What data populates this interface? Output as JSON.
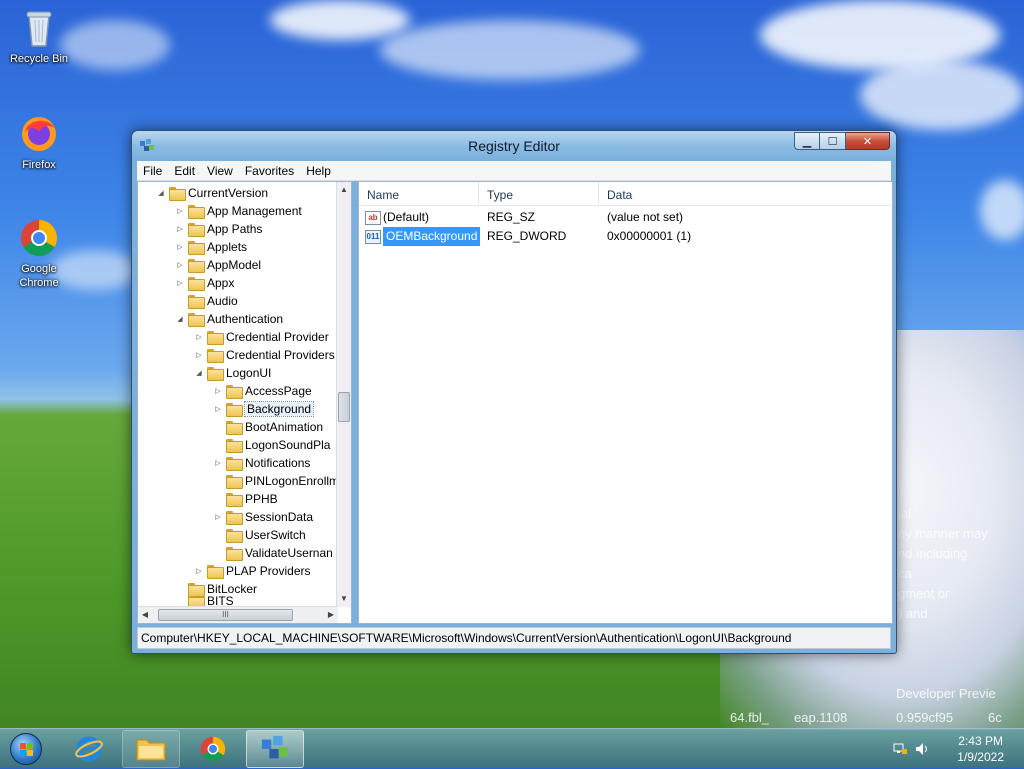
{
  "desktop": {
    "icons": [
      {
        "label": "Recycle Bin"
      },
      {
        "label": "Firefox"
      },
      {
        "label": "Google Chrome"
      }
    ],
    "wallpaper_text": [
      "ial",
      "ny manner may",
      "nd including",
      "ca",
      "gment or",
      ") and",
      "Developer Previe",
      "64.fbl_",
      "eap.1108",
      "0.959cf95",
      "6c"
    ]
  },
  "window": {
    "title": "Registry Editor",
    "caption_buttons": {
      "minimize": "▁",
      "maximize": "☐",
      "close": "✕"
    },
    "menu": [
      "File",
      "Edit",
      "View",
      "Favorites",
      "Help"
    ]
  },
  "tree": {
    "items": [
      {
        "label": "CurrentVersion",
        "expander": "◢"
      },
      {
        "label": "App Management",
        "expander": "▷"
      },
      {
        "label": "App Paths",
        "expander": "▷"
      },
      {
        "label": "Applets",
        "expander": "▷"
      },
      {
        "label": "AppModel",
        "expander": "▷"
      },
      {
        "label": "Appx",
        "expander": "▷"
      },
      {
        "label": "Audio",
        "expander": ""
      },
      {
        "label": "Authentication",
        "expander": "◢"
      },
      {
        "label": "Credential Provider",
        "expander": "▷"
      },
      {
        "label": "Credential Providers",
        "expander": "▷"
      },
      {
        "label": "LogonUI",
        "expander": "◢"
      },
      {
        "label": "AccessPage",
        "expander": "▷"
      },
      {
        "label": "Background",
        "expander": "▷"
      },
      {
        "label": "BootAnimation",
        "expander": ""
      },
      {
        "label": "LogonSoundPla",
        "expander": ""
      },
      {
        "label": "Notifications",
        "expander": "▷"
      },
      {
        "label": "PINLogonEnrollm",
        "expander": ""
      },
      {
        "label": "PPHB",
        "expander": ""
      },
      {
        "label": "SessionData",
        "expander": "▷"
      },
      {
        "label": "UserSwitch",
        "expander": ""
      },
      {
        "label": "ValidateUsernan",
        "expander": ""
      },
      {
        "label": "PLAP Providers",
        "expander": "▷"
      },
      {
        "label": "BitLocker",
        "expander": ""
      },
      {
        "label": "BITS",
        "expander": ""
      }
    ],
    "selected": "Background",
    "hscroll_thumb_label": "III"
  },
  "list": {
    "columns": [
      "Name",
      "Type",
      "Data"
    ],
    "rows": [
      {
        "name": "(Default)",
        "type": "REG_SZ",
        "data": "(value not set)",
        "icon": "ab"
      },
      {
        "name": "OEMBackground",
        "type": "REG_DWORD",
        "data": "0x00000001 (1)",
        "icon": "011"
      }
    ]
  },
  "status": {
    "path": "Computer\\HKEY_LOCAL_MACHINE\\SOFTWARE\\Microsoft\\Windows\\CurrentVersion\\Authentication\\LogonUI\\Background"
  },
  "taskbar": {
    "clock_time": "2:43 PM",
    "clock_date": "1/9/2022"
  },
  "colors": {
    "selection": "#3399ff",
    "title_gradient_top": "#b9d7f0",
    "close_button": "#c7503a"
  }
}
